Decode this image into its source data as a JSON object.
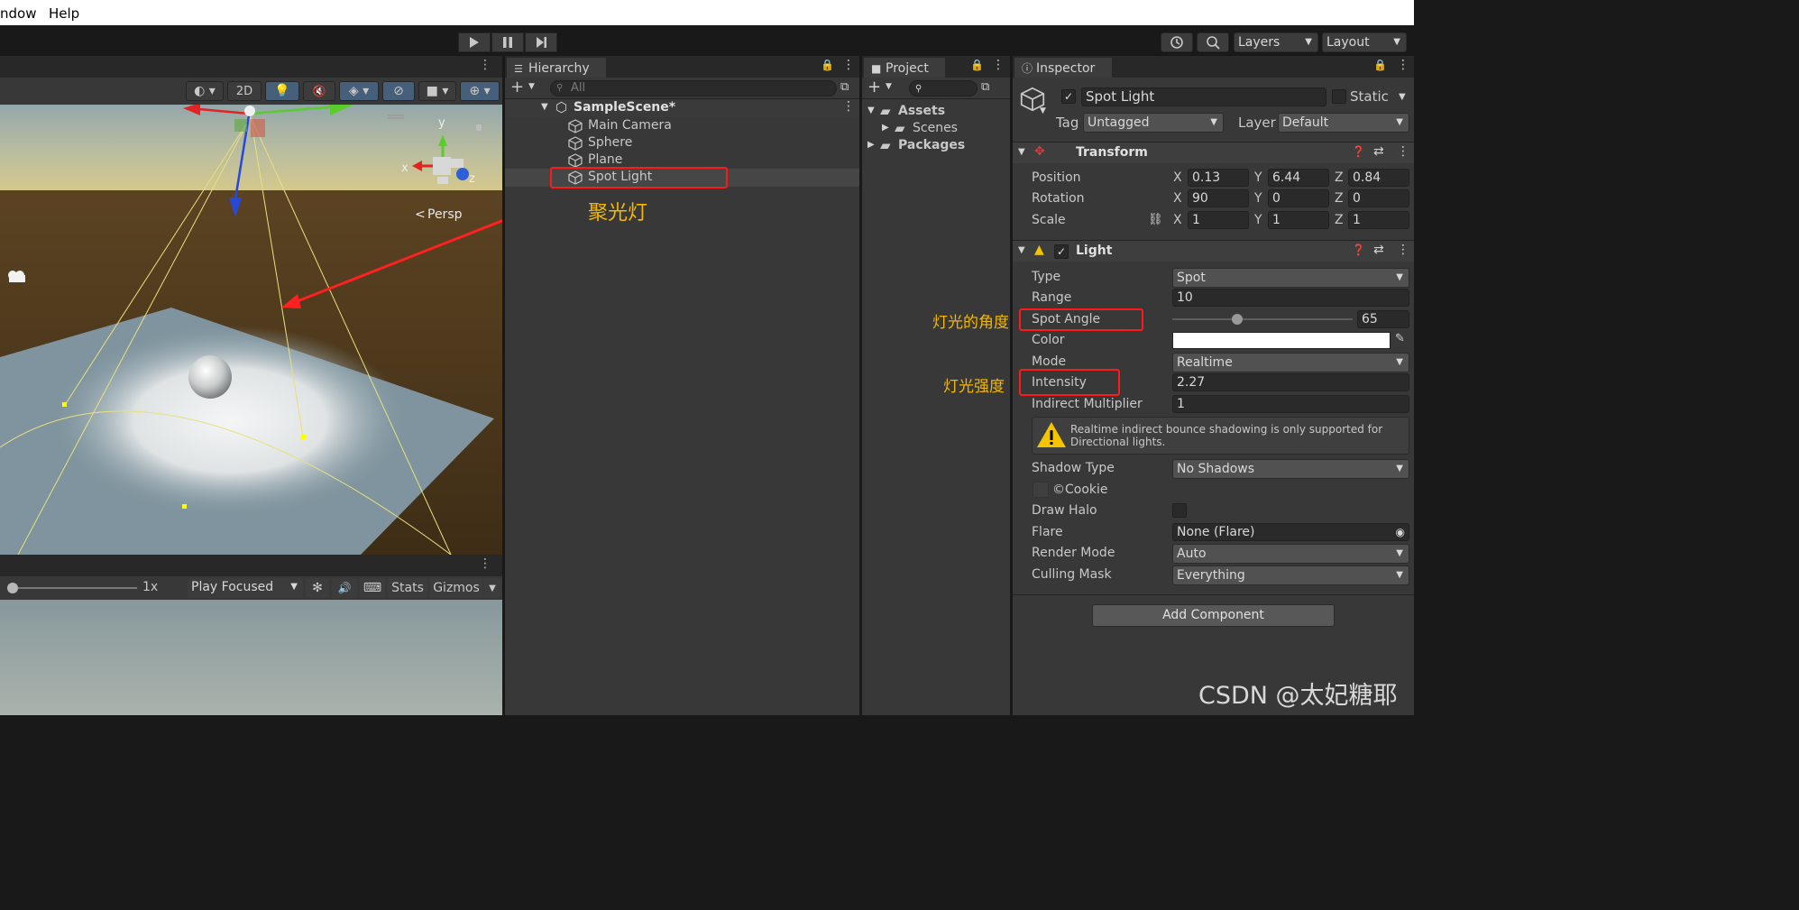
{
  "menu": {
    "window": "ndow",
    "help": "Help"
  },
  "toolbar": {
    "layers": "Layers",
    "layout": "Layout"
  },
  "scene": {
    "btn_2d": "2D",
    "persp": "Persp",
    "axis_x": "x",
    "axis_y": "y",
    "axis_z": "z"
  },
  "game": {
    "scale": "1x",
    "play_mode": "Play Focused",
    "stats": "Stats",
    "gizmos": "Gizmos"
  },
  "hierarchy": {
    "tab": "Hierarchy",
    "search_placeholder": "All",
    "scene": "SampleScene*",
    "items": [
      "Main Camera",
      "Sphere",
      "Plane",
      "Spot Light"
    ],
    "annotation": "聚光灯"
  },
  "project": {
    "tab": "Project",
    "assets": "Assets",
    "scenes": "Scenes",
    "packages": "Packages"
  },
  "inspector": {
    "tab": "Inspector",
    "object_name": "Spot Light",
    "static": "Static",
    "tag_label": "Tag",
    "tag_value": "Untagged",
    "layer_label": "Layer",
    "layer_value": "Default",
    "transform": {
      "title": "Transform",
      "position_label": "Position",
      "rotation_label": "Rotation",
      "scale_label": "Scale",
      "axis_x": "X",
      "axis_y": "Y",
      "axis_z": "Z",
      "position": [
        "0.13",
        "6.44",
        "0.84"
      ],
      "rotation": [
        "90",
        "0",
        "0"
      ],
      "scale": [
        "1",
        "1",
        "1"
      ]
    },
    "light": {
      "title": "Light",
      "type_label": "Type",
      "type_value": "Spot",
      "range_label": "Range",
      "range_value": "10",
      "spot_angle_label": "Spot Angle",
      "spot_angle_value": "65",
      "spot_angle_fraction": 0.36,
      "color_label": "Color",
      "color_value": "#ffffff",
      "mode_label": "Mode",
      "mode_value": "Realtime",
      "intensity_label": "Intensity",
      "intensity_value": "2.27",
      "indirect_label": "Indirect Multiplier",
      "indirect_value": "1",
      "warning": "Realtime indirect bounce shadowing is only supported for Directional lights.",
      "shadow_label": "Shadow Type",
      "shadow_value": "No Shadows",
      "cookie_label": "Cookie",
      "halo_label": "Draw Halo",
      "flare_label": "Flare",
      "flare_value": "None (Flare)",
      "render_label": "Render Mode",
      "render_value": "Auto",
      "culling_label": "Culling Mask",
      "culling_value": "Everything"
    },
    "add_component": "Add Component",
    "annotation_angle": "灯光的角度",
    "annotation_intensity": "灯光强度"
  },
  "watermark": "CSDN @太妃糖耶"
}
